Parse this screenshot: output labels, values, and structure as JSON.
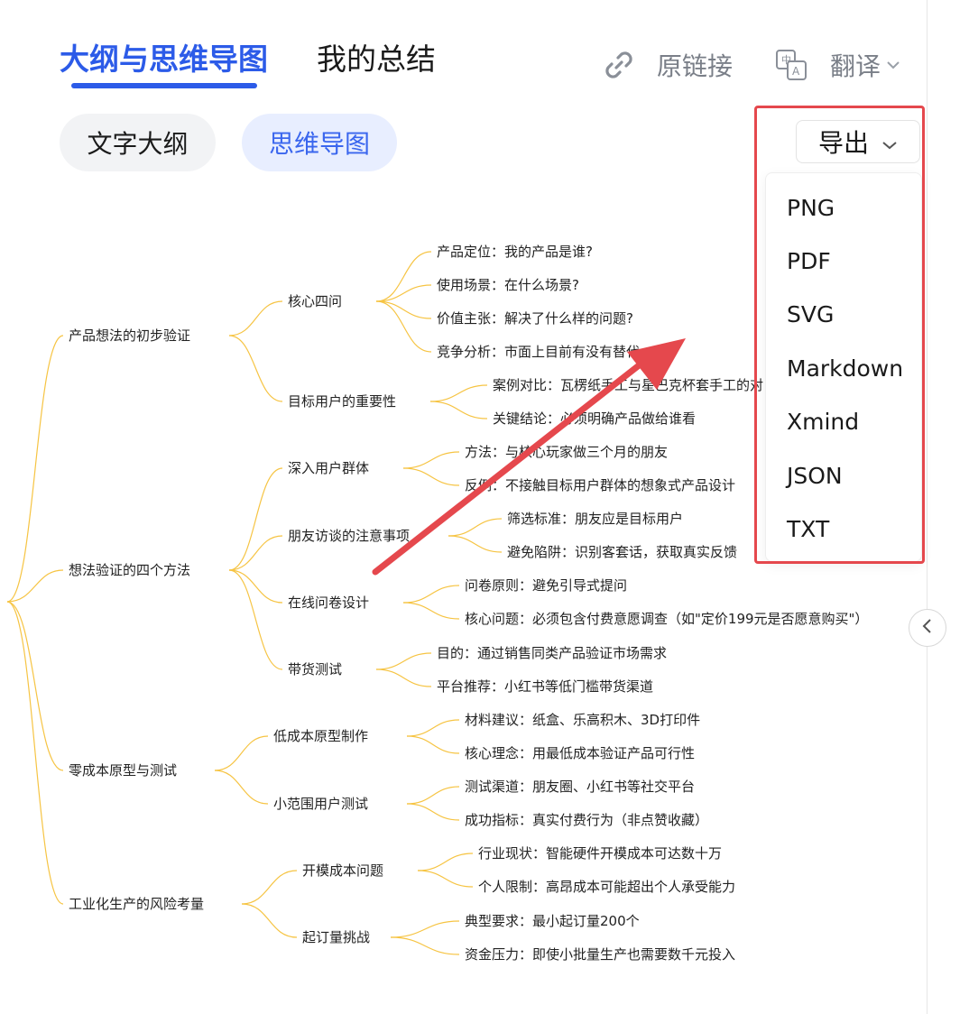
{
  "tabs": {
    "outline": "大纲与思维导图",
    "summary": "我的总结"
  },
  "toplinks": {
    "source": "原链接",
    "translate": "翻译"
  },
  "subtabs": {
    "text_outline": "文字大纲",
    "mind_map": "思维导图"
  },
  "export": {
    "label": "导出",
    "options": [
      "PNG",
      "PDF",
      "SVG",
      "Markdown",
      "Xmind",
      "JSON",
      "TXT"
    ]
  },
  "mindmap": {
    "branches": [
      {
        "label": "产品想法的初步验证",
        "children": [
          {
            "label": "核心四问",
            "children": [
              "产品定位：我的产品是谁?",
              "使用场景：在什么场景?",
              "价值主张：解决了什么样的问题?",
              "竞争分析：市面上目前有没有替代"
            ]
          },
          {
            "label": "目标用户的重要性",
            "children": [
              "案例对比：瓦楞纸手工与星巴克杯套手工的对",
              "关键结论：必须明确产品做给谁看"
            ]
          }
        ]
      },
      {
        "label": "想法验证的四个方法",
        "children": [
          {
            "label": "深入用户群体",
            "children": [
              "方法：与核心玩家做三个月的朋友",
              "反例：不接触目标用户群体的想象式产品设计"
            ]
          },
          {
            "label": "朋友访谈的注意事项",
            "children": [
              "筛选标准：朋友应是目标用户",
              "避免陷阱：识别客套话，获取真实反馈"
            ]
          },
          {
            "label": "在线问卷设计",
            "children": [
              "问卷原则：避免引导式提问",
              "核心问题：必须包含付费意愿调查（如\"定价199元是否愿意购买\"）"
            ]
          },
          {
            "label": "带货测试",
            "children": [
              "目的：通过销售同类产品验证市场需求",
              "平台推荐：小红书等低门槛带货渠道"
            ]
          }
        ]
      },
      {
        "label": "零成本原型与测试",
        "children": [
          {
            "label": "低成本原型制作",
            "children": [
              "材料建议：纸盒、乐高积木、3D打印件",
              "核心理念：用最低成本验证产品可行性"
            ]
          },
          {
            "label": "小范围用户测试",
            "children": [
              "测试渠道：朋友圈、小红书等社交平台",
              "成功指标：真实付费行为（非点赞收藏）"
            ]
          }
        ]
      },
      {
        "label": "工业化生产的风险考量",
        "children": [
          {
            "label": "开模成本问题",
            "children": [
              "行业现状：智能硬件开模成本可达数十万",
              "个人限制：高昂成本可能超出个人承受能力"
            ]
          },
          {
            "label": "起订量挑战",
            "children": [
              "典型要求：最小起订量200个",
              "资金压力：即使小批量生产也需要数千元投入"
            ]
          }
        ]
      }
    ]
  },
  "colors": {
    "accent": "#2c5be8",
    "link_line": "#f6c443",
    "highlight": "#e5484d"
  }
}
